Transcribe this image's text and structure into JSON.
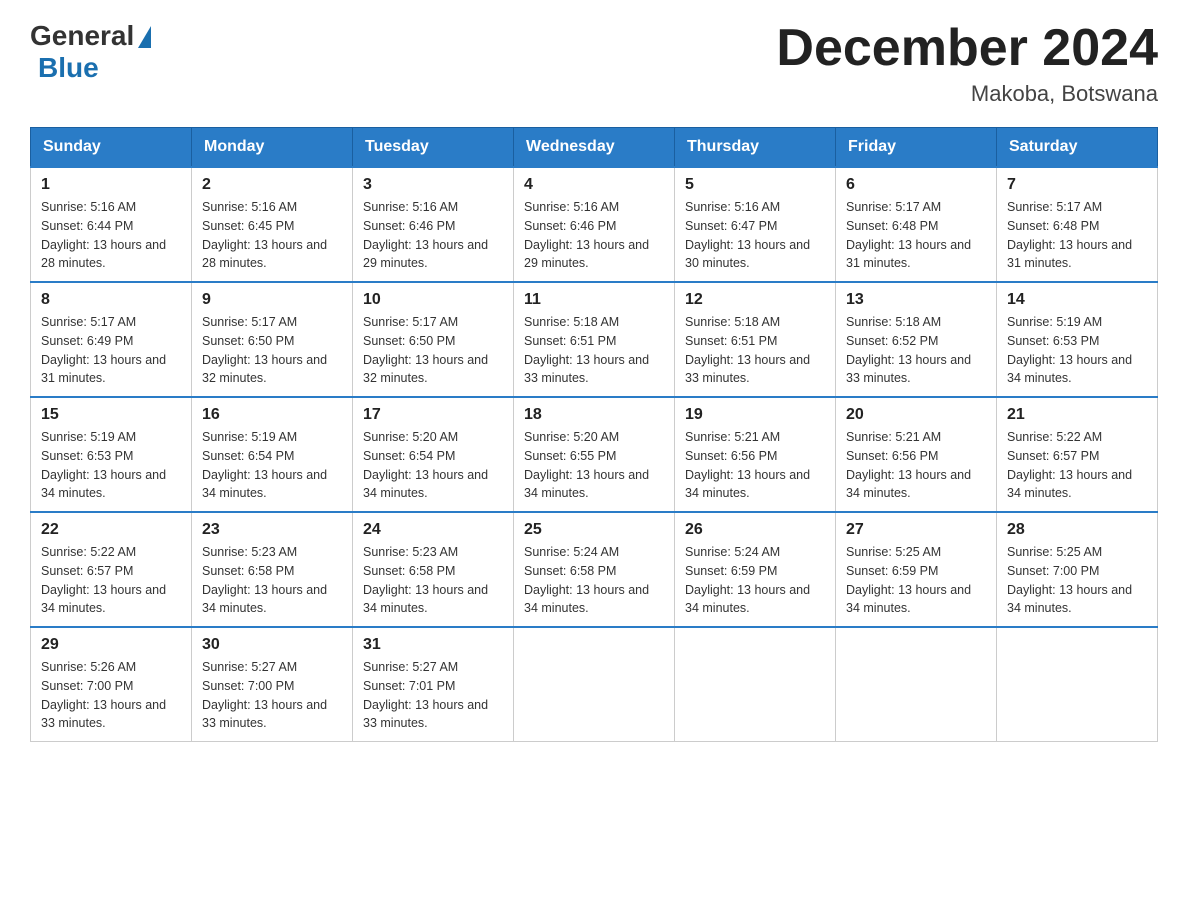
{
  "header": {
    "logo_general": "General",
    "logo_blue": "Blue",
    "month_title": "December 2024",
    "location": "Makoba, Botswana"
  },
  "days_of_week": [
    "Sunday",
    "Monday",
    "Tuesday",
    "Wednesday",
    "Thursday",
    "Friday",
    "Saturday"
  ],
  "weeks": [
    [
      {
        "day": "1",
        "sunrise": "Sunrise: 5:16 AM",
        "sunset": "Sunset: 6:44 PM",
        "daylight": "Daylight: 13 hours and 28 minutes."
      },
      {
        "day": "2",
        "sunrise": "Sunrise: 5:16 AM",
        "sunset": "Sunset: 6:45 PM",
        "daylight": "Daylight: 13 hours and 28 minutes."
      },
      {
        "day": "3",
        "sunrise": "Sunrise: 5:16 AM",
        "sunset": "Sunset: 6:46 PM",
        "daylight": "Daylight: 13 hours and 29 minutes."
      },
      {
        "day": "4",
        "sunrise": "Sunrise: 5:16 AM",
        "sunset": "Sunset: 6:46 PM",
        "daylight": "Daylight: 13 hours and 29 minutes."
      },
      {
        "day": "5",
        "sunrise": "Sunrise: 5:16 AM",
        "sunset": "Sunset: 6:47 PM",
        "daylight": "Daylight: 13 hours and 30 minutes."
      },
      {
        "day": "6",
        "sunrise": "Sunrise: 5:17 AM",
        "sunset": "Sunset: 6:48 PM",
        "daylight": "Daylight: 13 hours and 31 minutes."
      },
      {
        "day": "7",
        "sunrise": "Sunrise: 5:17 AM",
        "sunset": "Sunset: 6:48 PM",
        "daylight": "Daylight: 13 hours and 31 minutes."
      }
    ],
    [
      {
        "day": "8",
        "sunrise": "Sunrise: 5:17 AM",
        "sunset": "Sunset: 6:49 PM",
        "daylight": "Daylight: 13 hours and 31 minutes."
      },
      {
        "day": "9",
        "sunrise": "Sunrise: 5:17 AM",
        "sunset": "Sunset: 6:50 PM",
        "daylight": "Daylight: 13 hours and 32 minutes."
      },
      {
        "day": "10",
        "sunrise": "Sunrise: 5:17 AM",
        "sunset": "Sunset: 6:50 PM",
        "daylight": "Daylight: 13 hours and 32 minutes."
      },
      {
        "day": "11",
        "sunrise": "Sunrise: 5:18 AM",
        "sunset": "Sunset: 6:51 PM",
        "daylight": "Daylight: 13 hours and 33 minutes."
      },
      {
        "day": "12",
        "sunrise": "Sunrise: 5:18 AM",
        "sunset": "Sunset: 6:51 PM",
        "daylight": "Daylight: 13 hours and 33 minutes."
      },
      {
        "day": "13",
        "sunrise": "Sunrise: 5:18 AM",
        "sunset": "Sunset: 6:52 PM",
        "daylight": "Daylight: 13 hours and 33 minutes."
      },
      {
        "day": "14",
        "sunrise": "Sunrise: 5:19 AM",
        "sunset": "Sunset: 6:53 PM",
        "daylight": "Daylight: 13 hours and 34 minutes."
      }
    ],
    [
      {
        "day": "15",
        "sunrise": "Sunrise: 5:19 AM",
        "sunset": "Sunset: 6:53 PM",
        "daylight": "Daylight: 13 hours and 34 minutes."
      },
      {
        "day": "16",
        "sunrise": "Sunrise: 5:19 AM",
        "sunset": "Sunset: 6:54 PM",
        "daylight": "Daylight: 13 hours and 34 minutes."
      },
      {
        "day": "17",
        "sunrise": "Sunrise: 5:20 AM",
        "sunset": "Sunset: 6:54 PM",
        "daylight": "Daylight: 13 hours and 34 minutes."
      },
      {
        "day": "18",
        "sunrise": "Sunrise: 5:20 AM",
        "sunset": "Sunset: 6:55 PM",
        "daylight": "Daylight: 13 hours and 34 minutes."
      },
      {
        "day": "19",
        "sunrise": "Sunrise: 5:21 AM",
        "sunset": "Sunset: 6:56 PM",
        "daylight": "Daylight: 13 hours and 34 minutes."
      },
      {
        "day": "20",
        "sunrise": "Sunrise: 5:21 AM",
        "sunset": "Sunset: 6:56 PM",
        "daylight": "Daylight: 13 hours and 34 minutes."
      },
      {
        "day": "21",
        "sunrise": "Sunrise: 5:22 AM",
        "sunset": "Sunset: 6:57 PM",
        "daylight": "Daylight: 13 hours and 34 minutes."
      }
    ],
    [
      {
        "day": "22",
        "sunrise": "Sunrise: 5:22 AM",
        "sunset": "Sunset: 6:57 PM",
        "daylight": "Daylight: 13 hours and 34 minutes."
      },
      {
        "day": "23",
        "sunrise": "Sunrise: 5:23 AM",
        "sunset": "Sunset: 6:58 PM",
        "daylight": "Daylight: 13 hours and 34 minutes."
      },
      {
        "day": "24",
        "sunrise": "Sunrise: 5:23 AM",
        "sunset": "Sunset: 6:58 PM",
        "daylight": "Daylight: 13 hours and 34 minutes."
      },
      {
        "day": "25",
        "sunrise": "Sunrise: 5:24 AM",
        "sunset": "Sunset: 6:58 PM",
        "daylight": "Daylight: 13 hours and 34 minutes."
      },
      {
        "day": "26",
        "sunrise": "Sunrise: 5:24 AM",
        "sunset": "Sunset: 6:59 PM",
        "daylight": "Daylight: 13 hours and 34 minutes."
      },
      {
        "day": "27",
        "sunrise": "Sunrise: 5:25 AM",
        "sunset": "Sunset: 6:59 PM",
        "daylight": "Daylight: 13 hours and 34 minutes."
      },
      {
        "day": "28",
        "sunrise": "Sunrise: 5:25 AM",
        "sunset": "Sunset: 7:00 PM",
        "daylight": "Daylight: 13 hours and 34 minutes."
      }
    ],
    [
      {
        "day": "29",
        "sunrise": "Sunrise: 5:26 AM",
        "sunset": "Sunset: 7:00 PM",
        "daylight": "Daylight: 13 hours and 33 minutes."
      },
      {
        "day": "30",
        "sunrise": "Sunrise: 5:27 AM",
        "sunset": "Sunset: 7:00 PM",
        "daylight": "Daylight: 13 hours and 33 minutes."
      },
      {
        "day": "31",
        "sunrise": "Sunrise: 5:27 AM",
        "sunset": "Sunset: 7:01 PM",
        "daylight": "Daylight: 13 hours and 33 minutes."
      },
      null,
      null,
      null,
      null
    ]
  ]
}
